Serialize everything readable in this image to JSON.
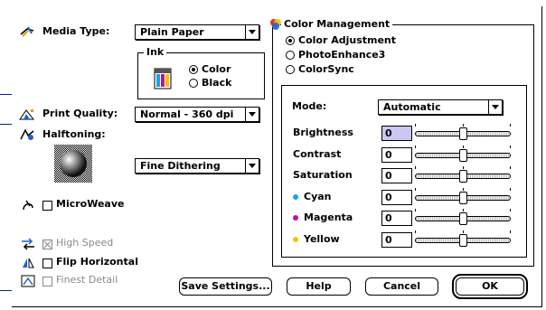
{
  "media": {
    "label": "Media Type:",
    "value": "Plain Paper"
  },
  "ink": {
    "title": "Ink",
    "options": [
      "Color",
      "Black"
    ],
    "selected": "Color"
  },
  "print_quality": {
    "label": "Print Quality:",
    "value": "Normal - 360 dpi"
  },
  "halftoning": {
    "label": "Halftoning:",
    "value": "Fine Dithering"
  },
  "microweave": {
    "label": "MicroWeave",
    "checked": false
  },
  "high_speed": {
    "label": "High Speed",
    "checked": true,
    "enabled": false
  },
  "flip_horizontal": {
    "label": "Flip Horizontal",
    "checked": false
  },
  "finest_detail": {
    "label": "Finest Detail",
    "checked": false,
    "enabled": false
  },
  "color_mgmt": {
    "title": "Color Management",
    "options": [
      "Color Adjustment",
      "PhotoEnhance3",
      "ColorSync"
    ],
    "selected": "Color Adjustment",
    "mode_label": "Mode:",
    "mode_value": "Automatic",
    "sliders": [
      {
        "label": "Brightness",
        "value": "0",
        "level": 0.5,
        "dot": ""
      },
      {
        "label": "Contrast",
        "value": "0",
        "level": 0.5,
        "dot": ""
      },
      {
        "label": "Saturation",
        "value": "0",
        "level": 0.5,
        "dot": ""
      },
      {
        "label": "Cyan",
        "value": "0",
        "level": 0.5,
        "dot": "#12a7e8"
      },
      {
        "label": "Magenta",
        "value": "0",
        "level": 0.5,
        "dot": "#c4128f"
      },
      {
        "label": "Yellow",
        "value": "0",
        "level": 0.5,
        "dot": "#f2c200"
      }
    ]
  },
  "buttons": {
    "save": "Save Settings...",
    "help": "Help",
    "cancel": "Cancel",
    "ok": "OK"
  },
  "colors": {
    "callout": "#0a1e8c",
    "selected_field": "#c8c8f0"
  }
}
